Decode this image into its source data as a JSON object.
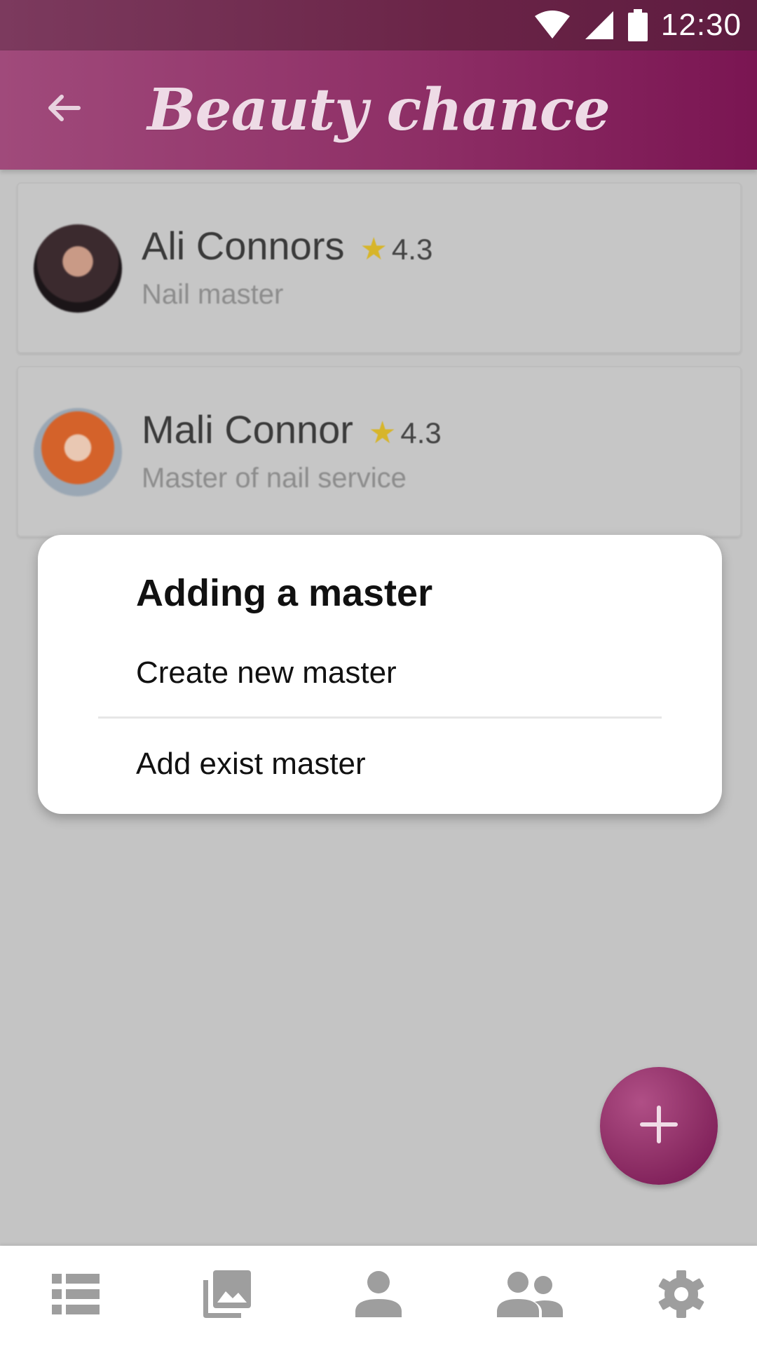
{
  "status_bar": {
    "time": "12:30",
    "icons": [
      "wifi-icon",
      "cell-signal-icon",
      "battery-icon"
    ]
  },
  "app_bar": {
    "title": "Beauty chance",
    "back_icon": "arrow-back-icon"
  },
  "masters": [
    {
      "name": "Ali Connors",
      "rating": "4.3",
      "role": "Nail master"
    },
    {
      "name": "Mali Connor",
      "rating": "4.3",
      "role": "Master of nail service"
    }
  ],
  "dialog": {
    "title": "Adding a master",
    "options": [
      "Create new master",
      "Add exist master"
    ]
  },
  "fab": {
    "icon": "plus-icon"
  },
  "bottom_nav": {
    "items": [
      "list-icon",
      "gallery-icon",
      "person-icon",
      "group-icon",
      "settings-icon"
    ]
  },
  "colors": {
    "primary": "#8e2f66",
    "primary_dark": "#6a2447",
    "star": "#d7b52a",
    "scrim": "#c4c4c4",
    "nav_icon": "#9e9e9e"
  }
}
